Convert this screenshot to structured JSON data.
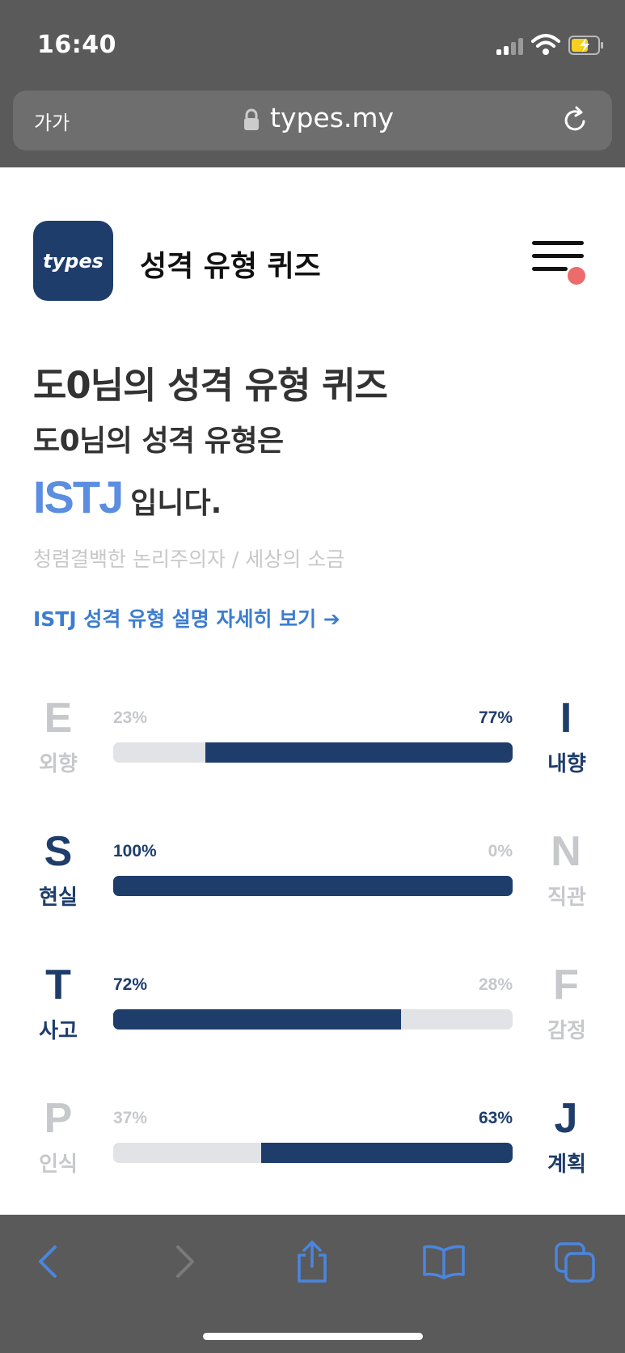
{
  "status_bar": {
    "time": "16:40"
  },
  "browser": {
    "text_size_label": "가가",
    "url": "types.my",
    "accent_color": "#5b8ee0"
  },
  "header": {
    "logo_text": "types",
    "site_title": "성격 유형 퀴즈"
  },
  "result": {
    "quiz_title": "도0님의 성격 유형 퀴즈",
    "result_line": "도0님의 성격 유형은",
    "type_code": "ISTJ",
    "type_suffix": "입니다.",
    "type_description": "청렴결백한 논리주의자 / 세상의 소금",
    "detail_link": "ISTJ 성격 유형 설명 자세히 보기"
  },
  "dimensions": [
    {
      "left_letter": "E",
      "left_word": "외향",
      "left_pct": "23%",
      "right_letter": "I",
      "right_word": "내향",
      "right_pct": "77%",
      "left_fraction": 0.23,
      "dominant": "right"
    },
    {
      "left_letter": "S",
      "left_word": "현실",
      "left_pct": "100%",
      "right_letter": "N",
      "right_word": "직관",
      "right_pct": "0%",
      "left_fraction": 1.0,
      "dominant": "left"
    },
    {
      "left_letter": "T",
      "left_word": "사고",
      "left_pct": "72%",
      "right_letter": "F",
      "right_word": "감정",
      "right_pct": "28%",
      "left_fraction": 0.72,
      "dominant": "left"
    },
    {
      "left_letter": "P",
      "left_word": "인식",
      "left_pct": "37%",
      "right_letter": "J",
      "right_word": "계획",
      "right_pct": "63%",
      "left_fraction": 0.37,
      "dominant": "right"
    }
  ],
  "colors": {
    "bar_fill": "#1e3d6b",
    "bar_track": "#e2e3e7",
    "inactive_text": "#c6c8cc",
    "link": "#3c7dd0",
    "notification_dot": "#ec6b6b"
  },
  "toolbar": {
    "icons": [
      "back-icon",
      "forward-icon",
      "share-icon",
      "bookmarks-icon",
      "tabs-icon"
    ]
  }
}
